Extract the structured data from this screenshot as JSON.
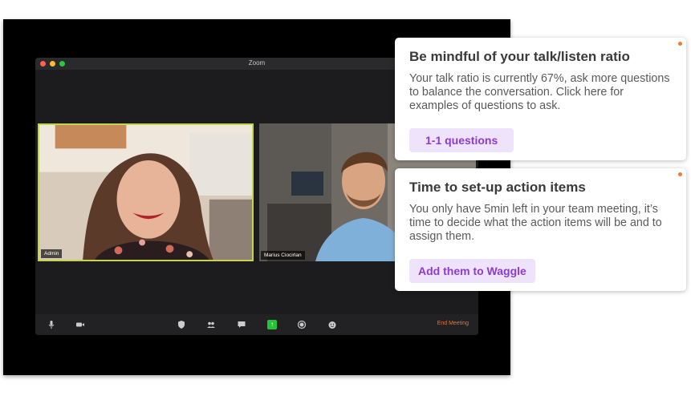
{
  "zoom": {
    "window_title": "Zoom",
    "participants": [
      {
        "name": "Admin"
      },
      {
        "name": "Marius Ciocirlan"
      }
    ],
    "toolbar": {
      "icons": [
        "microphone-icon",
        "video-camera-icon",
        "shield-icon",
        "participants-icon",
        "chat-icon",
        "share-screen-icon",
        "record-icon",
        "reactions-icon"
      ],
      "share_glyph": "↑",
      "end_label": "End Meeting",
      "end_color": "#e9762b"
    }
  },
  "cards": [
    {
      "title": "Be mindful of your talk/listen ratio",
      "body": "Your talk ratio is currently 67%, ask more questions to balance the conversation. Click here for examples of questions to ask.",
      "button": "1-1 questions"
    },
    {
      "title": "Time to set-up action items",
      "body": "You only have 5min left in your team meeting, it’s time to decide what the action items will be and to assign them.",
      "button": "Add them to Waggle"
    }
  ],
  "colors": {
    "accent_purple": "#8a3ccf",
    "button_bg": "#efe3fb",
    "notification_dot": "#ef7a36",
    "active_speaker_border": "#c3d64b",
    "share_green": "#27c23a"
  }
}
